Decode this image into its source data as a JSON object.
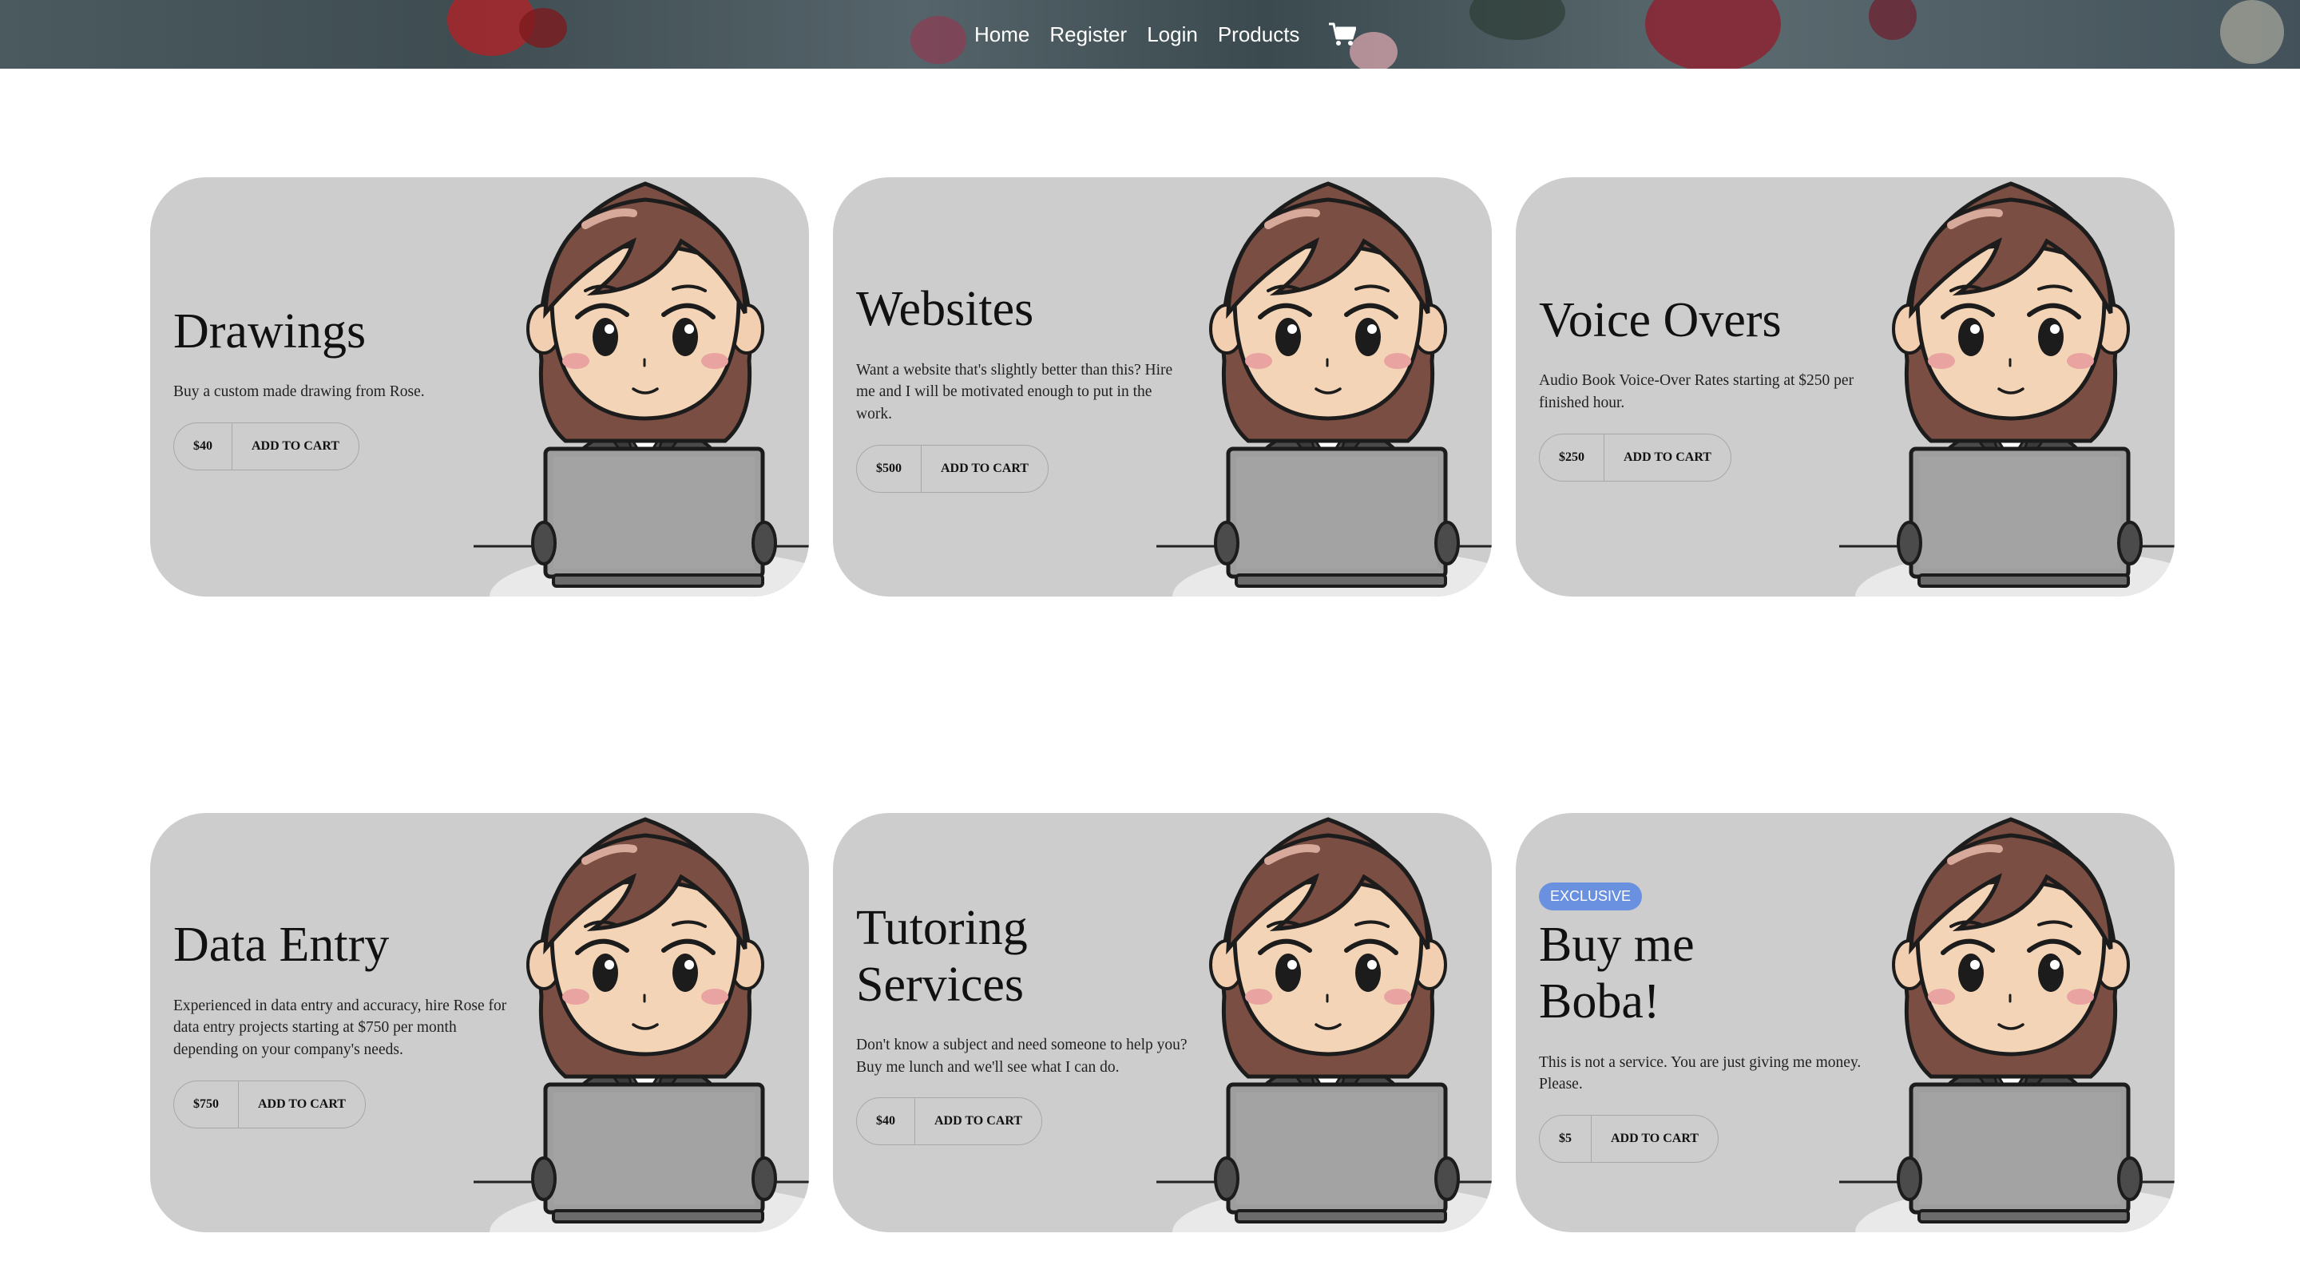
{
  "nav": {
    "items": [
      "Home",
      "Register",
      "Login",
      "Products"
    ],
    "cart_icon": "shopping-cart-icon"
  },
  "products": [
    {
      "title": "Drawings",
      "description": "Buy a custom made drawing from Rose.",
      "price": "$40",
      "cta": "ADD TO CART"
    },
    {
      "title": "Websites",
      "description": "Want a website that's slightly better than this? Hire me and I will be motivated enough to put in the work.",
      "price": "$500",
      "cta": "ADD TO CART"
    },
    {
      "title": "Voice Overs",
      "description": "Audio Book Voice-Over Rates starting at $250 per finished hour.",
      "price": "$250",
      "cta": "ADD TO CART"
    },
    {
      "title": "Data Entry",
      "description": "Experienced in data entry and accuracy, hire Rose for data entry projects starting at $750 per month depending on your company's needs.",
      "price": "$750",
      "cta": "ADD TO CART"
    },
    {
      "title": "Tutoring Services",
      "description": "Don't know a subject and need someone to help you? Buy me lunch and we'll see what I can do.",
      "price": "$40",
      "cta": "ADD TO CART"
    },
    {
      "title": "Buy me Boba!",
      "badge": "EXCLUSIVE",
      "description": "This is not a service. You are just giving me money. Please.",
      "price": "$5",
      "cta": "ADD TO CART"
    }
  ],
  "colors": {
    "card_bg": "#cdcdcd",
    "badge_bg": "#6a90e0",
    "header_bg": "#46555a"
  },
  "illustration": "girl-with-laptop-illustration"
}
